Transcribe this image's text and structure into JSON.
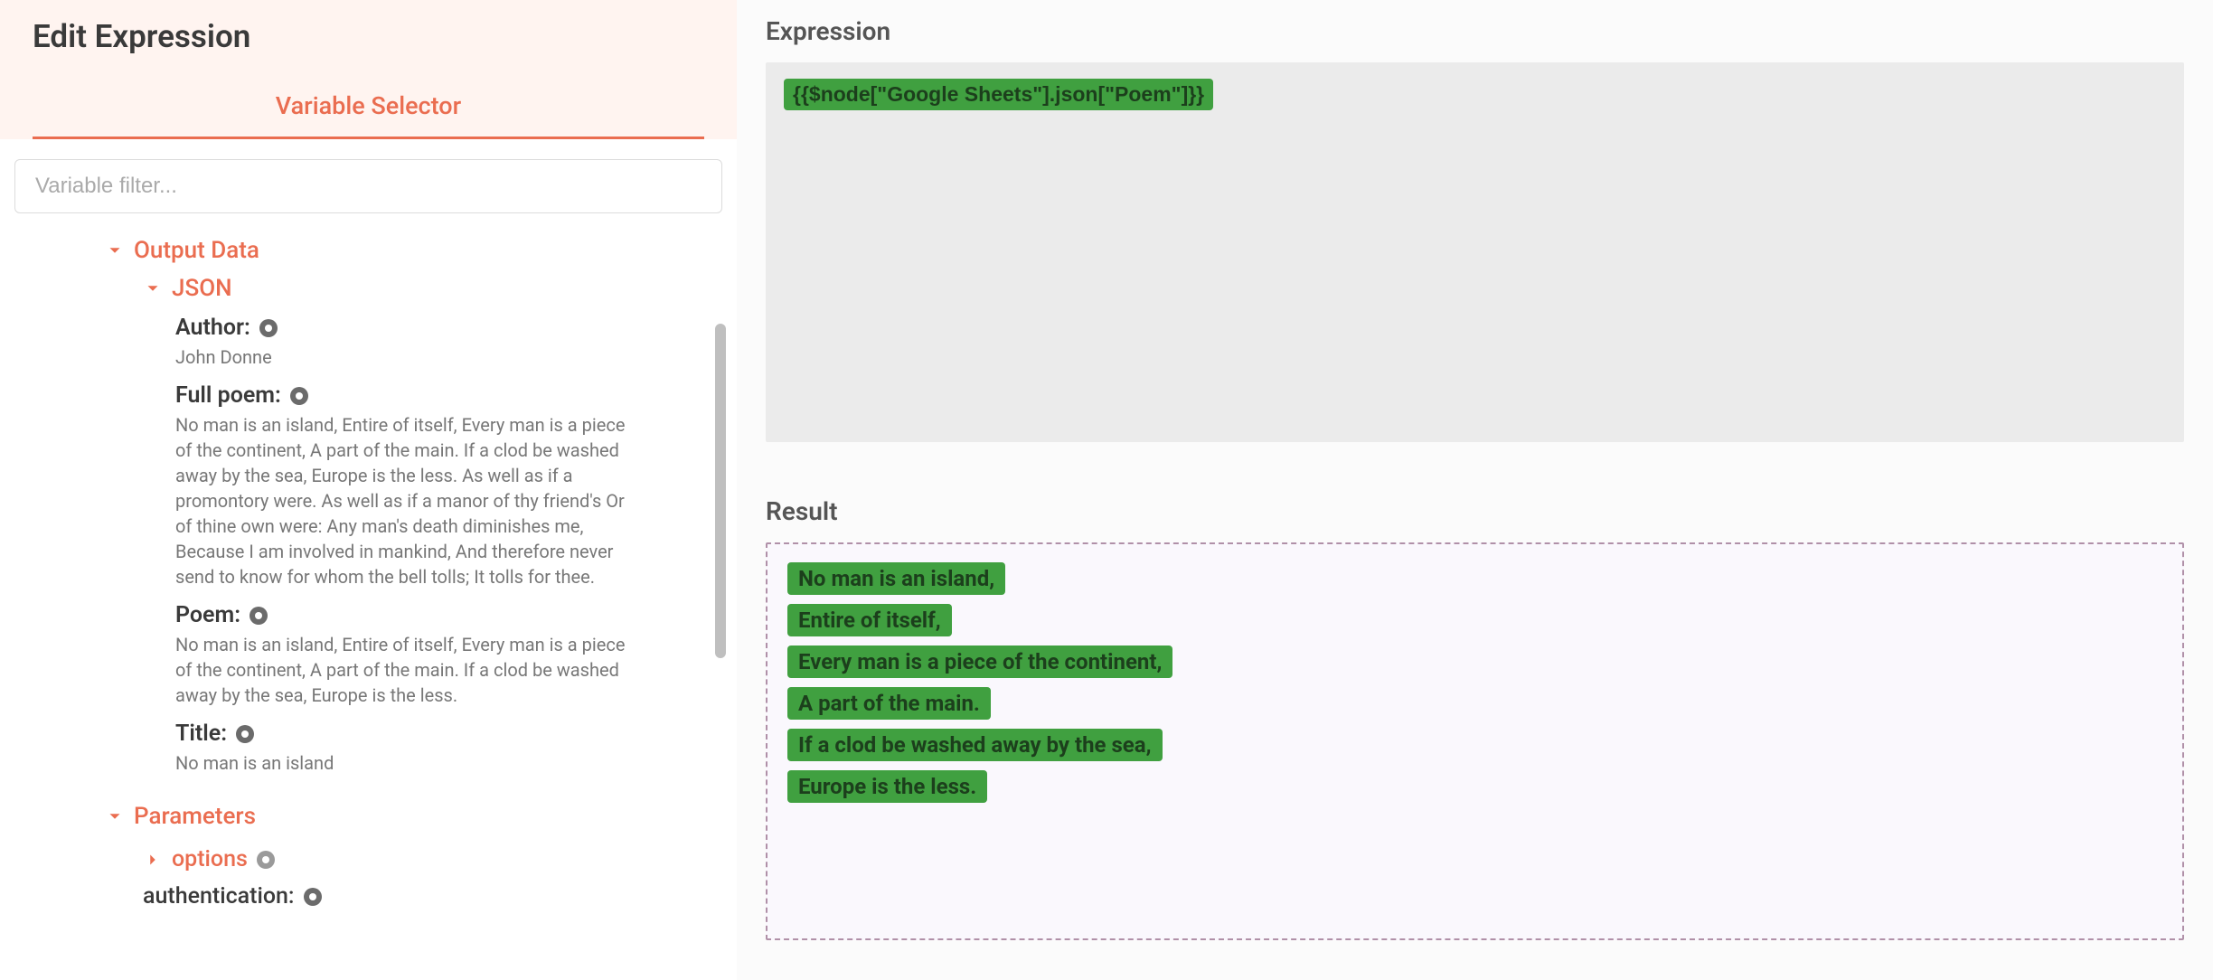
{
  "header": {
    "title": "Edit Expression",
    "tab": "Variable Selector"
  },
  "filter": {
    "placeholder": "Variable filter..."
  },
  "tree": {
    "output_data_label": "Output Data",
    "json_label": "JSON",
    "fields": [
      {
        "key": "Author:",
        "value": "John Donne"
      },
      {
        "key": "Full poem:",
        "value": "No man is an island, Entire of itself, Every man is a piece of the continent, A part of the main. If a clod be washed away by the sea, Europe is the less. As well as if a promontory were. As well as if a manor of thy friend's Or of thine own were: Any man's death diminishes me, Because I am involved in mankind, And therefore never send to know for whom the bell tolls; It tolls for thee."
      },
      {
        "key": "Poem:",
        "value": "No man is an island, Entire of itself, Every man is a piece of the continent, A part of the main. If a clod be washed away by the sea, Europe is the less."
      },
      {
        "key": "Title:",
        "value": "No man is an island"
      }
    ],
    "parameters_label": "Parameters",
    "options_label": "options",
    "authentication_label": "authentication:"
  },
  "expression": {
    "label": "Expression",
    "value": "{{$node[\"Google Sheets\"].json[\"Poem\"]}}"
  },
  "result": {
    "label": "Result",
    "lines": [
      "No man is an island,",
      "Entire of itself,",
      "Every man is a piece of the continent,",
      "A part of the main.",
      "If a clod be washed away by the sea,",
      "Europe is the less."
    ]
  },
  "colors": {
    "accent": "#ea6d50",
    "token_bg": "#40a040",
    "token_fg": "#1c3f1c"
  }
}
